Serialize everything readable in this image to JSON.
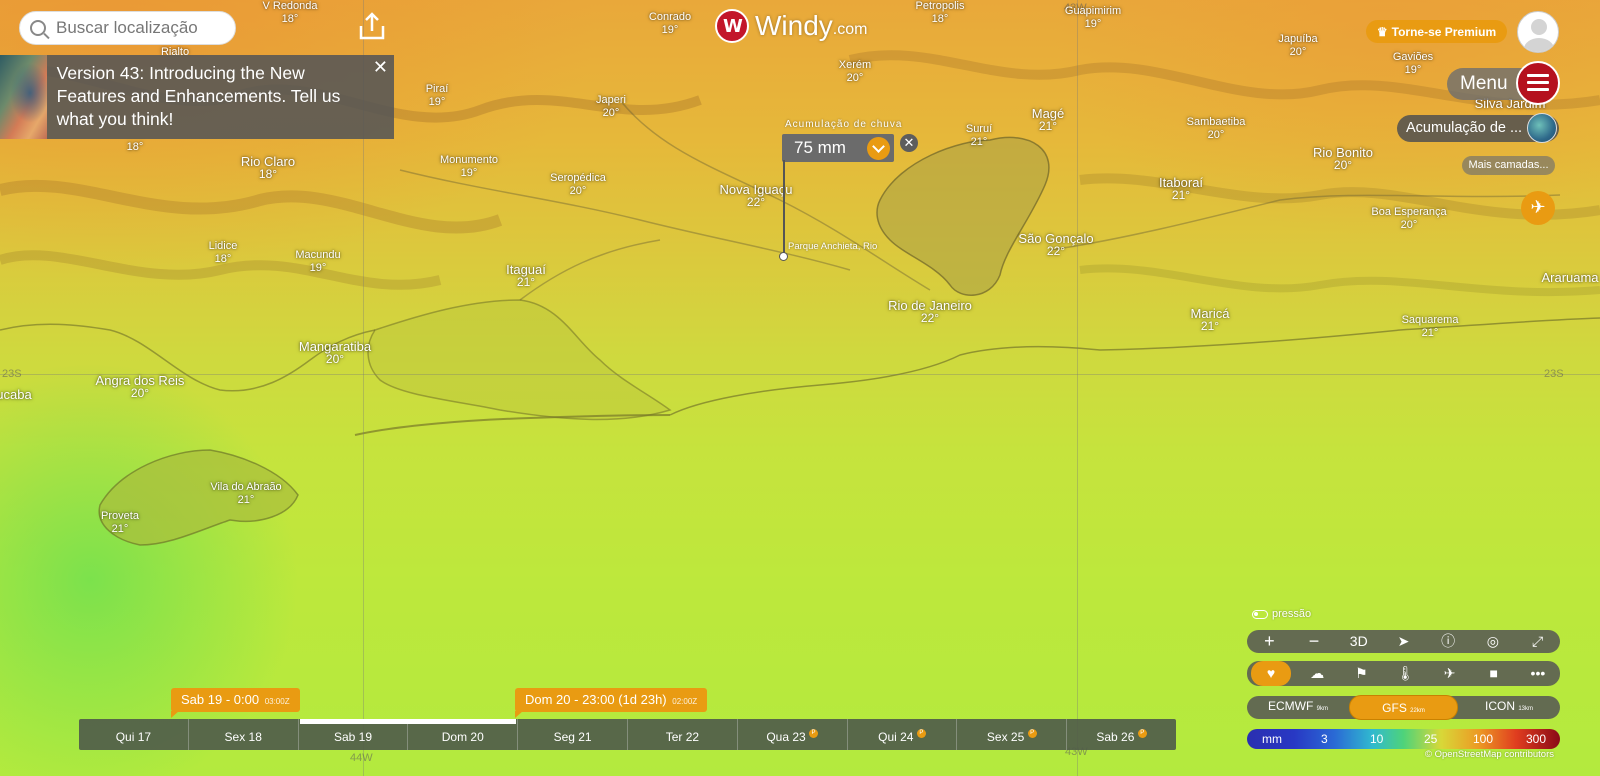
{
  "search": {
    "placeholder": "Buscar localização"
  },
  "logo": {
    "name": "Windy",
    "suffix": ".com"
  },
  "announcement": {
    "text": "Version 43: Introducing the New Features and Enhancements. Tell us what you think!",
    "close": "✕"
  },
  "picker": {
    "title": "Acumulação de chuva",
    "value": "75 mm",
    "close": "✕",
    "poi": "Parque Anchieta, Rio"
  },
  "topright": {
    "premium": "Torne-se Premium",
    "menu": "Menu",
    "layer": "Acumulação de ...",
    "more_layers": "Mais camadas..."
  },
  "grid": {
    "lat_left": "23S",
    "lat_right": "23S",
    "lon_mid": "43W",
    "lon_bottom": "44W",
    "lon_top": "43W"
  },
  "places": [
    {
      "name": "V Redonda",
      "temp": "18°"
    },
    {
      "name": "Rialto",
      "temp": ""
    },
    {
      "name": "Conrado",
      "temp": "19°"
    },
    {
      "name": "Petropolis",
      "temp": "18°"
    },
    {
      "name": "Guapimirim",
      "temp": "19°"
    },
    {
      "name": "Japuíba",
      "temp": "20°"
    },
    {
      "name": "Gaviões",
      "temp": "19°"
    },
    {
      "name": "Piraí",
      "temp": "19°"
    },
    {
      "name": "Xerém",
      "temp": "20°"
    },
    {
      "name": "Japeri",
      "temp": "20°"
    },
    {
      "name": "Magé",
      "temp": "21°"
    },
    {
      "name": "Silva Jardim",
      "temp": ""
    },
    {
      "name": "Sambaetiba",
      "temp": "20°"
    },
    {
      "name": "Suruí",
      "temp": "21°"
    },
    {
      "name": "Rio Bonito",
      "temp": "20°"
    },
    {
      "name": "Monumento",
      "temp": "19°"
    },
    {
      "name": "Rio Claro",
      "temp": "18°"
    },
    {
      "name": "Seropédica",
      "temp": "20°"
    },
    {
      "name": "Nova Iguaçu",
      "temp": "22°"
    },
    {
      "name": "Itaboraí",
      "temp": "21°"
    },
    {
      "name": "Boa Esperança",
      "temp": "20°"
    },
    {
      "name": "Lidice",
      "temp": "18°"
    },
    {
      "name": "Macundu",
      "temp": "19°"
    },
    {
      "name": "São Gonçalo",
      "temp": "22°"
    },
    {
      "name": "Itaguaí",
      "temp": "21°"
    },
    {
      "name": "Araruama",
      "temp": ""
    },
    {
      "name": "Rio de Janeiro",
      "temp": "22°"
    },
    {
      "name": "Maricá",
      "temp": "21°"
    },
    {
      "name": "Saquarema",
      "temp": "21°"
    },
    {
      "name": "Mangaratiba",
      "temp": "20°"
    },
    {
      "name": "Angra dos Reis",
      "temp": "20°"
    },
    {
      "name": "ucaba",
      "temp": ""
    },
    {
      "name": "Vila do Abraão",
      "temp": "21°"
    },
    {
      "name": "Proveta",
      "temp": "21°"
    },
    {
      "name": "18°",
      "temp": ""
    }
  ],
  "controls": {
    "pressure": "pressão",
    "zoom_in": "+",
    "zoom_out": "−",
    "three_d": "3D",
    "models": [
      {
        "name": "ECMWF",
        "res": "9km"
      },
      {
        "name": "GFS",
        "res": "22km"
      },
      {
        "name": "ICON",
        "res": "13km"
      }
    ],
    "legend": {
      "unit": "mm",
      "values": [
        "3",
        "10",
        "25",
        "100",
        "300"
      ]
    },
    "osm": "© OpenStreetMap contributors"
  },
  "timeline": {
    "start_label": "Sab 19 - 0:00",
    "start_utc": "03:00Z",
    "end_label": "Dom 20 - 23:00 (1d 23h)",
    "end_utc": "02:00Z",
    "days": [
      {
        "label": "Qui 17",
        "premium": false
      },
      {
        "label": "Sex 18",
        "premium": false
      },
      {
        "label": "Sab 19",
        "premium": false
      },
      {
        "label": "Dom 20",
        "premium": false
      },
      {
        "label": "Seg 21",
        "premium": false
      },
      {
        "label": "Ter 22",
        "premium": false
      },
      {
        "label": "Qua 23",
        "premium": true
      },
      {
        "label": "Qui 24",
        "premium": true
      },
      {
        "label": "Sex 25",
        "premium": true
      },
      {
        "label": "Sab 26",
        "premium": true
      }
    ],
    "premium_mark": "P"
  },
  "colors": {
    "accent": "#e99b12",
    "brand": "#c3162a"
  },
  "icons": [
    "search-icon",
    "share-icon",
    "close-icon",
    "chevron-down-icon",
    "user-icon",
    "hamburger-icon",
    "plane-icon",
    "heart-icon",
    "weather-icon",
    "flag-icon",
    "thermometer-icon",
    "camera-icon",
    "more-icon",
    "info-icon",
    "location-icon",
    "fullscreen-icon",
    "radar-icon"
  ]
}
